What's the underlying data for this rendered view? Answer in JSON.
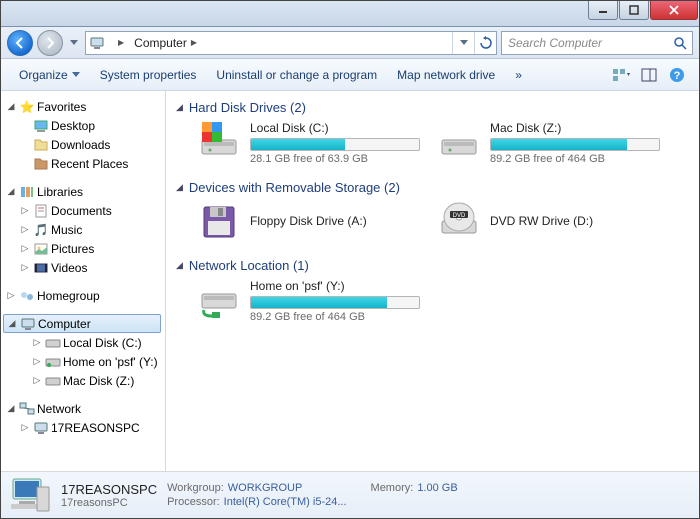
{
  "address": {
    "location": "Computer"
  },
  "search": {
    "placeholder": "Search Computer"
  },
  "toolbar": {
    "organize": "Organize",
    "system_properties": "System properties",
    "uninstall": "Uninstall or change a program",
    "map_drive": "Map network drive"
  },
  "tree": {
    "favorites": "Favorites",
    "desktop": "Desktop",
    "downloads": "Downloads",
    "recent": "Recent Places",
    "libraries": "Libraries",
    "documents": "Documents",
    "music": "Music",
    "pictures": "Pictures",
    "videos": "Videos",
    "homegroup": "Homegroup",
    "computer": "Computer",
    "local_c": "Local Disk (C:)",
    "home_y": "Home on 'psf' (Y:)",
    "mac_z": "Mac Disk (Z:)",
    "network": "Network",
    "pc1": "17REASONSPC"
  },
  "groups": {
    "hdd": "Hard Disk Drives (2)",
    "removable": "Devices with Removable Storage (2)",
    "network": "Network Location (1)"
  },
  "drives": {
    "c": {
      "name": "Local Disk (C:)",
      "free": "28.1 GB free of 63.9 GB",
      "pct": 56
    },
    "z": {
      "name": "Mac Disk (Z:)",
      "free": "89.2 GB free of 464 GB",
      "pct": 81
    },
    "a": {
      "name": "Floppy Disk Drive (A:)"
    },
    "d": {
      "name": "DVD RW Drive (D:)"
    },
    "y": {
      "name": "Home on 'psf' (Y:)",
      "free": "89.2 GB free of 464 GB",
      "pct": 81
    }
  },
  "details": {
    "name": "17REASONSPC",
    "sub": "17reasonsPC",
    "workgroup_k": "Workgroup:",
    "workgroup_v": "WORKGROUP",
    "processor_k": "Processor:",
    "processor_v": "Intel(R) Core(TM) i5-24...",
    "memory_k": "Memory:",
    "memory_v": "1.00 GB"
  }
}
